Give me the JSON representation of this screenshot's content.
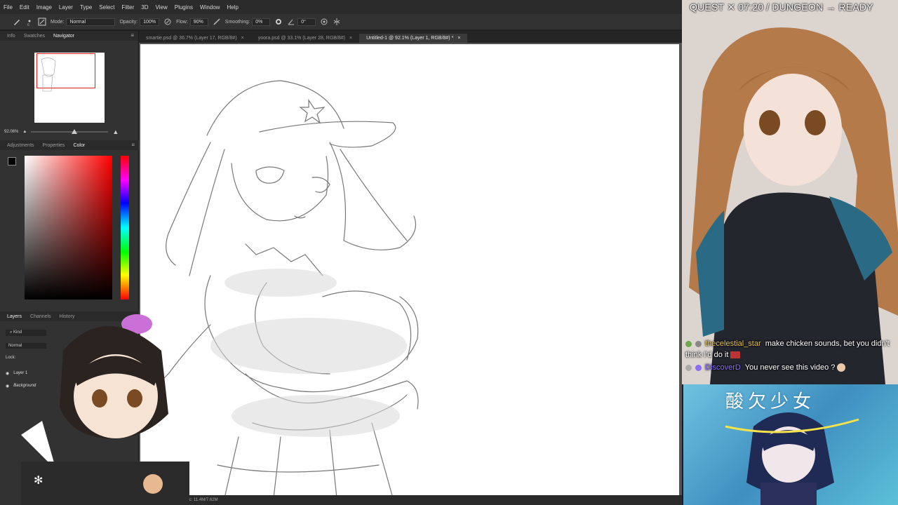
{
  "menu": [
    "File",
    "Edit",
    "Image",
    "Layer",
    "Type",
    "Select",
    "Filter",
    "3D",
    "View",
    "Plugins",
    "Window",
    "Help"
  ],
  "options": {
    "mode_label": "Mode:",
    "mode_value": "Normal",
    "opacity_label": "Opacity:",
    "opacity_value": "100%",
    "flow_label": "Flow:",
    "flow_value": "90%",
    "smoothing_label": "Smoothing:",
    "smoothing_value": "0%",
    "angle_value": "0°"
  },
  "tabs": [
    {
      "label": "smartie.psd @ 36.7% (Layer 17, RGB/8#)",
      "active": false
    },
    {
      "label": "yoora.psd @ 33.1% (Layer 28, RGB/8#)",
      "active": false
    },
    {
      "label": "Untitled-1 @ 92.1% (Layer 1, RGB/8#) *",
      "active": true
    }
  ],
  "navigator": {
    "tabs": [
      "Info",
      "Swatches",
      "Navigator"
    ],
    "zoom": "92.06%",
    "zoom_fraction": 0.56
  },
  "color_panel": {
    "tabs": [
      "Adjustments",
      "Properties",
      "Color"
    ],
    "foreground": "#000000",
    "background": "#ffffff"
  },
  "layers_panel": {
    "tabs": [
      "Layers",
      "Channels",
      "History"
    ],
    "filter_label": "Kind",
    "blend_mode": "Normal",
    "lock_label": "Lock:",
    "layers": [
      "Layer 1",
      "Background"
    ]
  },
  "statusbar": {
    "doc_info": "Doc: 11.4M/7.62M"
  },
  "stream": {
    "quest_label": "QUEST",
    "timer": "07:20",
    "separator": "/",
    "dungeon_label": "DUNGEON",
    "dungeon_status": "READY"
  },
  "chat": [
    {
      "user": "thecelestial_star",
      "message": "make chicken sounds, bet you didn't think I'd do it"
    },
    {
      "user": "DiscoverD",
      "message": "You never see this video ?"
    }
  ],
  "album": {
    "title": "酸欠少女"
  },
  "colors": {
    "accent_red": "#e02020",
    "chat_user_1": "#e8c34a",
    "chat_user_2": "#8b6cff"
  }
}
